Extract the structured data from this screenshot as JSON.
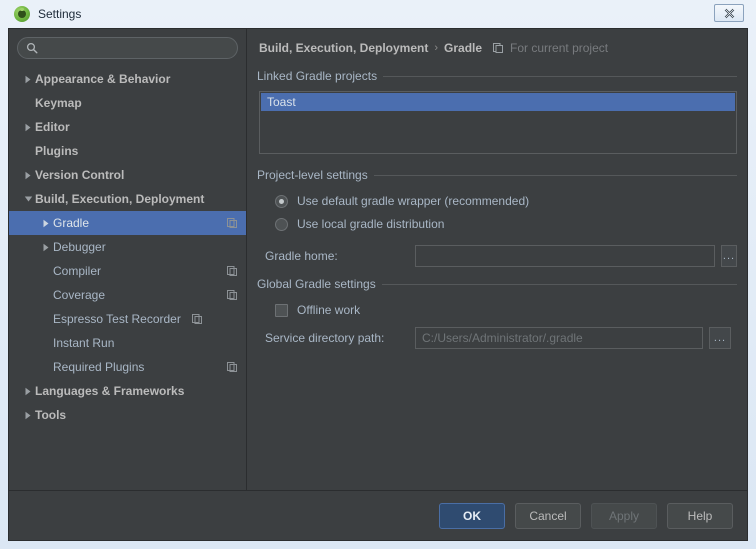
{
  "window": {
    "title": "Settings",
    "app_icon": "android-studio-icon",
    "close_icon": "close-icon"
  },
  "search": {
    "icon": "search-icon",
    "value": "",
    "placeholder": ""
  },
  "sidebar": {
    "items": [
      {
        "label": "Appearance & Behavior",
        "level": 0,
        "top": true,
        "arrow": "collapsed",
        "copy": false,
        "selected": false
      },
      {
        "label": "Keymap",
        "level": 0,
        "top": true,
        "arrow": "none",
        "copy": false,
        "selected": false
      },
      {
        "label": "Editor",
        "level": 0,
        "top": true,
        "arrow": "collapsed",
        "copy": false,
        "selected": false
      },
      {
        "label": "Plugins",
        "level": 0,
        "top": true,
        "arrow": "none",
        "copy": false,
        "selected": false
      },
      {
        "label": "Version Control",
        "level": 0,
        "top": true,
        "arrow": "collapsed",
        "copy": false,
        "selected": false
      },
      {
        "label": "Build, Execution, Deployment",
        "level": 0,
        "top": true,
        "arrow": "expanded",
        "copy": false,
        "selected": false
      },
      {
        "label": "Gradle",
        "level": 1,
        "top": false,
        "arrow": "collapsed",
        "copy": true,
        "copy_inline": false,
        "selected": true
      },
      {
        "label": "Debugger",
        "level": 1,
        "top": false,
        "arrow": "collapsed",
        "copy": false,
        "selected": false
      },
      {
        "label": "Compiler",
        "level": 1,
        "top": false,
        "arrow": "none",
        "copy": true,
        "copy_inline": false,
        "selected": false
      },
      {
        "label": "Coverage",
        "level": 1,
        "top": false,
        "arrow": "none",
        "copy": true,
        "copy_inline": false,
        "selected": false
      },
      {
        "label": "Espresso Test Recorder",
        "level": 1,
        "top": false,
        "arrow": "none",
        "copy": true,
        "copy_inline": true,
        "selected": false
      },
      {
        "label": "Instant Run",
        "level": 1,
        "top": false,
        "arrow": "none",
        "copy": false,
        "selected": false
      },
      {
        "label": "Required Plugins",
        "level": 1,
        "top": false,
        "arrow": "none",
        "copy": true,
        "copy_inline": false,
        "selected": false
      },
      {
        "label": "Languages & Frameworks",
        "level": 0,
        "top": true,
        "arrow": "collapsed",
        "copy": false,
        "selected": false
      },
      {
        "label": "Tools",
        "level": 0,
        "top": true,
        "arrow": "collapsed",
        "copy": false,
        "selected": false
      }
    ]
  },
  "breadcrumb": {
    "parent": "Build, Execution, Deployment",
    "separator": "›",
    "current": "Gradle",
    "scope_icon": "copy-icon",
    "scope_note": "For current project"
  },
  "main": {
    "linked_projects": {
      "header": "Linked Gradle projects",
      "items": [
        {
          "label": "Toast",
          "selected": true
        }
      ]
    },
    "project_level": {
      "header": "Project-level settings",
      "radios": [
        {
          "label": "Use default gradle wrapper (recommended)",
          "checked": true
        },
        {
          "label": "Use local gradle distribution",
          "checked": false
        }
      ],
      "gradle_home": {
        "label": "Gradle home:",
        "value": "",
        "browse_label": "..."
      }
    },
    "global_settings": {
      "header": "Global Gradle settings",
      "offline_work": {
        "label": "Offline work",
        "checked": false
      },
      "service_directory": {
        "label": "Service directory path:",
        "value": "C:/Users/Administrator/.gradle",
        "browse_label": "..."
      }
    }
  },
  "footer": {
    "buttons": [
      {
        "label": "OK",
        "style": "default"
      },
      {
        "label": "Cancel",
        "style": "normal"
      },
      {
        "label": "Apply",
        "style": "disabled"
      },
      {
        "label": "Help",
        "style": "normal"
      }
    ]
  },
  "colors": {
    "accent": "#4b6eaf",
    "panel": "#3c3f41",
    "text": "#a9b7c6",
    "frame": "#d7e4f2"
  }
}
